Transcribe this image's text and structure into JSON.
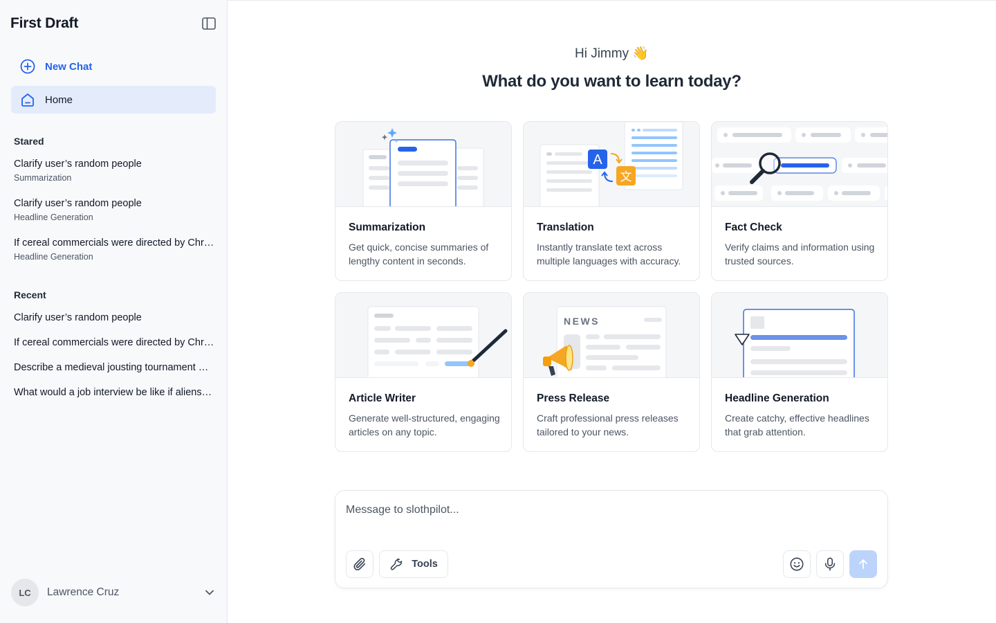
{
  "sidebar": {
    "brand": "First Draft",
    "new_chat": "New Chat",
    "home": "Home",
    "stared_title": "Stared",
    "stared": [
      {
        "title": "Clarify user’s random people",
        "subtitle": "Summarization"
      },
      {
        "title": "Clarify user’s random people",
        "subtitle": "Headline Generation"
      },
      {
        "title": "If cereal commercials were directed by Christopher Nolan",
        "subtitle": "Headline Generation"
      }
    ],
    "recent_title": "Recent",
    "recent": [
      "Clarify user’s random people",
      "If cereal commercials were directed by Christopher Nolan",
      "Describe a medieval jousting tournament with modern sports commentary",
      "What would a job interview be like if aliens ran the company"
    ],
    "user": {
      "initials": "LC",
      "name": "Lawrence Cruz"
    }
  },
  "main": {
    "greeting": "Hi Jimmy 👋",
    "headline": "What do you want to learn today?",
    "cards": [
      {
        "title": "Summarization",
        "desc": "Get quick, concise summaries of lengthy content in seconds."
      },
      {
        "title": "Translation",
        "desc": "Instantly translate text across multiple languages with accuracy."
      },
      {
        "title": "Fact Check",
        "desc": "Verify claims and information using trusted sources."
      },
      {
        "title": "Article Writer",
        "desc": "Generate well-structured, engaging articles on any topic."
      },
      {
        "title": "Press Release",
        "desc": "Craft professional press releases tailored to your news."
      },
      {
        "title": "Headline Generation",
        "desc": "Create catchy, effective headlines that grab attention."
      }
    ],
    "illus_text": {
      "translate_a": "A",
      "translate_zh": "文",
      "news": "NEWS"
    }
  },
  "composer": {
    "placeholder": "Message to slothpilot...",
    "tools_label": "Tools"
  },
  "colors": {
    "accent": "#2563eb",
    "active_bg": "#e4ecfb",
    "send_bg": "#bcd4fb"
  },
  "icons": [
    "plus-circle-icon",
    "home-icon",
    "sidebar-toggle-icon",
    "chevron-down-icon",
    "paperclip-icon",
    "wrench-icon",
    "smile-icon",
    "microphone-icon",
    "arrow-up-icon"
  ]
}
